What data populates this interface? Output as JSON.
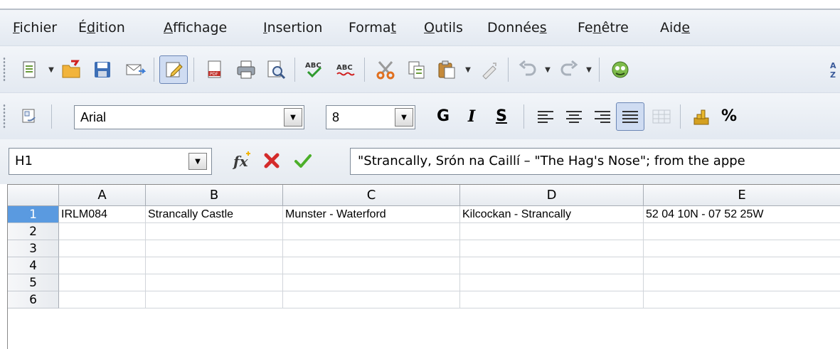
{
  "menubar": {
    "items": [
      {
        "label": "Fichier",
        "mnemonic": "F"
      },
      {
        "label": "Édition",
        "mnemonic": "d"
      },
      {
        "label": "Affichage",
        "mnemonic": "A"
      },
      {
        "label": "Insertion",
        "mnemonic": "I"
      },
      {
        "label": "Format",
        "mnemonic": "t"
      },
      {
        "label": "Outils",
        "mnemonic": "O"
      },
      {
        "label": "Données",
        "mnemonic": "s"
      },
      {
        "label": "Fenêtre",
        "mnemonic": "n"
      },
      {
        "label": "Aide",
        "mnemonic": "e"
      }
    ]
  },
  "toolbar_standard": {
    "icons": [
      "new-document-icon",
      "open-folder-icon",
      "save-icon",
      "email-icon",
      "edit-mode-icon",
      "export-pdf-icon",
      "print-icon",
      "page-preview-icon",
      "spellcheck-icon",
      "autospellcheck-icon",
      "cut-icon",
      "copy-icon",
      "paste-icon",
      "clone-format-icon",
      "undo-icon",
      "redo-icon",
      "navigator-icon",
      "sort-icon"
    ]
  },
  "toolbar_format": {
    "font_name": "Arial",
    "font_size": "8",
    "bold_label": "G",
    "italic_label": "I",
    "underline_label": "S",
    "percent_label": "%"
  },
  "formula_bar": {
    "name_box": "H1",
    "content": "\"Strancally, Srón na Caillí – \"The Hag's Nose\"; from the appe"
  },
  "sheet": {
    "columns": [
      "A",
      "B",
      "C",
      "D",
      "E"
    ],
    "rows": [
      "1",
      "2",
      "3",
      "4",
      "5",
      "6"
    ],
    "selected_row": "1",
    "row1": [
      "IRLM084",
      "Strancally Castle",
      "Munster - Waterford",
      "Kilcockan - Strancally",
      "52 04 10N - 07 52 25W"
    ]
  },
  "colors": {
    "selection": "#5a9ae0",
    "toolbar_bg": "#e8edf3"
  }
}
